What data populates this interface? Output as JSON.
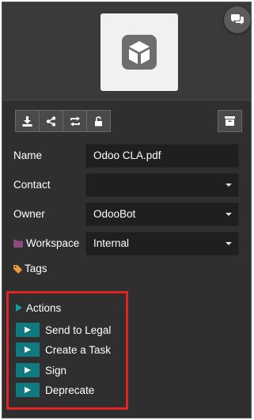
{
  "toolbar": {
    "buttons": [
      {
        "icon": "download-icon"
      },
      {
        "icon": "share-icon"
      },
      {
        "icon": "replace-icon"
      },
      {
        "icon": "lock-icon"
      }
    ],
    "archive_icon": "archive-icon"
  },
  "fields": {
    "name": {
      "label": "Name",
      "value": "Odoo CLA.pdf"
    },
    "contact": {
      "label": "Contact",
      "value": ""
    },
    "owner": {
      "label": "Owner",
      "value": "OdooBot"
    },
    "workspace": {
      "label": "Workspace",
      "value": "Internal",
      "icon": "folder-icon"
    },
    "tags": {
      "label": "Tags",
      "icon": "tag-icon"
    }
  },
  "actions": {
    "title": "Actions",
    "items": [
      {
        "label": "Send to Legal"
      },
      {
        "label": "Create a Task"
      },
      {
        "label": "Sign"
      },
      {
        "label": "Deprecate"
      }
    ]
  },
  "colors": {
    "panel_bg": "#2f2f2f",
    "field_bg": "#1f1f1f",
    "accent_teal": "#117a80",
    "highlight_red": "#e02424"
  }
}
